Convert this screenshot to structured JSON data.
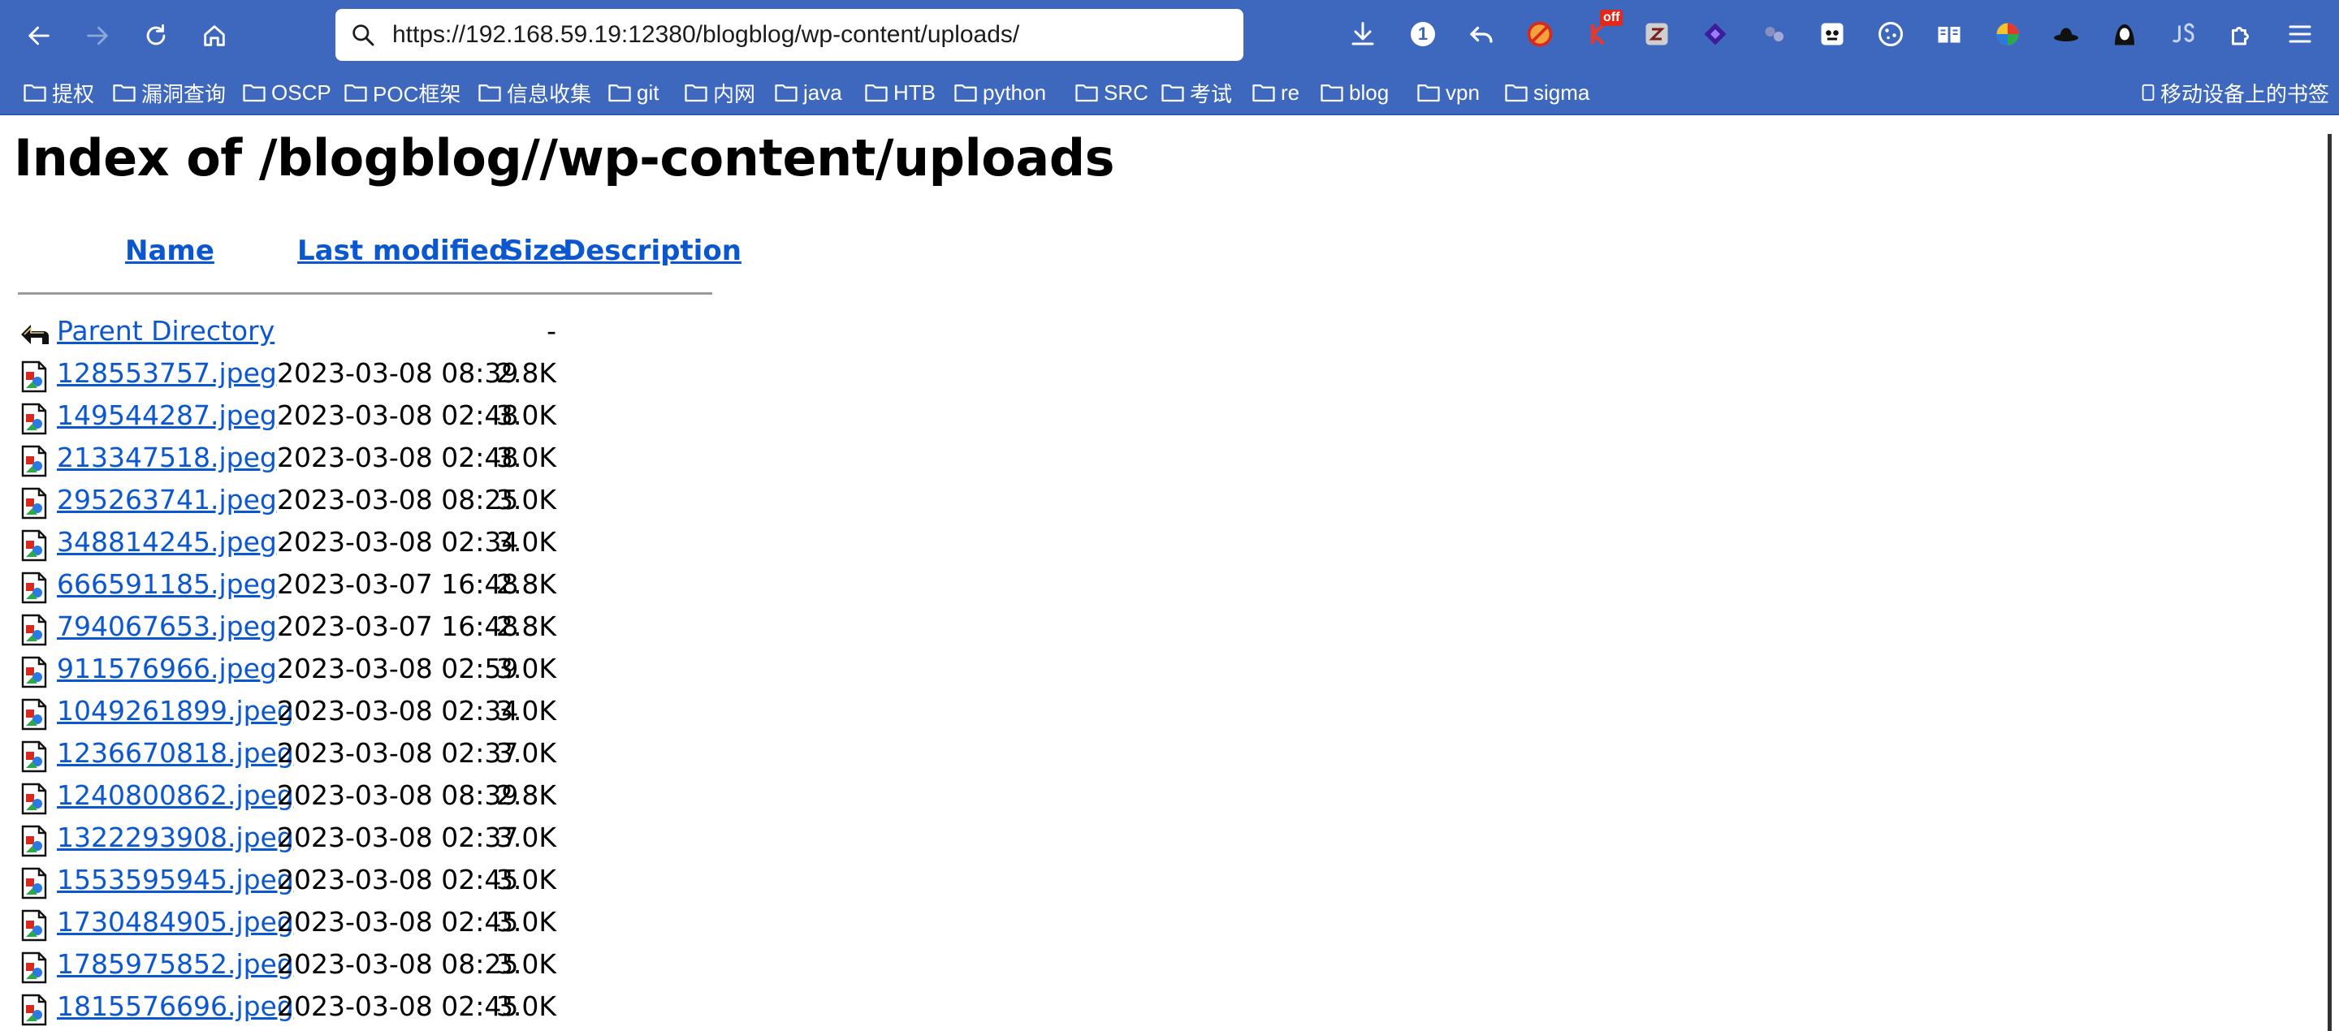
{
  "browser": {
    "url": "https://192.168.59.19:12380/blogblog/wp-content/uploads/",
    "extension_badge_count": "1",
    "off_badge": "off",
    "nav_icons": [
      "back-icon",
      "forward-icon",
      "reload-icon",
      "home-icon"
    ],
    "extension_icons": [
      "download-icon",
      "counter-badge-icon",
      "undo-icon",
      "blocker-icon",
      "k-off-icon",
      "zotero-icon",
      "diamond-icon",
      "dots-icon",
      "panda-icon",
      "cookie-icon",
      "reader-icon",
      "color-picker-icon",
      "hat-icon",
      "hacker-icon",
      "js-icon",
      "extensions-icon",
      "menu-icon"
    ]
  },
  "bookmarks": {
    "folders": [
      "提权",
      "漏洞查询",
      "OSCP",
      "POC框架",
      "信息收集",
      "git",
      "内网",
      "java",
      "HTB",
      "python",
      "SRC",
      "考试",
      "re",
      "blog",
      "vpn",
      "sigma"
    ],
    "mobile": "移动设备上的书签"
  },
  "page": {
    "title": "Index of /blogblog//wp-content/uploads",
    "headers": {
      "name": "Name",
      "last_modified": "Last modified",
      "size": "Size",
      "description": "Description"
    },
    "parent": {
      "name": "Parent Directory",
      "size": "-"
    },
    "files": [
      {
        "name": "128553757.jpeg",
        "modified": "2023-03-08 08:39",
        "size": "2.8K"
      },
      {
        "name": "149544287.jpeg",
        "modified": "2023-03-08 02:48",
        "size": "3.0K"
      },
      {
        "name": "213347518.jpeg",
        "modified": "2023-03-08 02:48",
        "size": "3.0K"
      },
      {
        "name": "295263741.jpeg",
        "modified": "2023-03-08 08:25",
        "size": "3.0K"
      },
      {
        "name": "348814245.jpeg",
        "modified": "2023-03-08 02:34",
        "size": "3.0K"
      },
      {
        "name": "666591185.jpeg",
        "modified": "2023-03-07 16:48",
        "size": "2.8K"
      },
      {
        "name": "794067653.jpeg",
        "modified": "2023-03-07 16:48",
        "size": "2.8K"
      },
      {
        "name": "911576966.jpeg",
        "modified": "2023-03-08 02:59",
        "size": "3.0K"
      },
      {
        "name": "1049261899.jpeg",
        "modified": "2023-03-08 02:34",
        "size": "3.0K"
      },
      {
        "name": "1236670818.jpeg",
        "modified": "2023-03-08 02:37",
        "size": "3.0K"
      },
      {
        "name": "1240800862.jpeg",
        "modified": "2023-03-08 08:39",
        "size": "2.8K"
      },
      {
        "name": "1322293908.jpeg",
        "modified": "2023-03-08 02:37",
        "size": "3.0K"
      },
      {
        "name": "1553595945.jpeg",
        "modified": "2023-03-08 02:45",
        "size": "3.0K"
      },
      {
        "name": "1730484905.jpeg",
        "modified": "2023-03-08 02:45",
        "size": "3.0K"
      },
      {
        "name": "1785975852.jpeg",
        "modified": "2023-03-08 08:25",
        "size": "3.0K"
      },
      {
        "name": "1815576696.jpeg",
        "modified": "2023-03-08 02:45",
        "size": "3.0K"
      }
    ]
  },
  "colors": {
    "chrome": "#3e68bd",
    "link": "#0b57d0"
  }
}
